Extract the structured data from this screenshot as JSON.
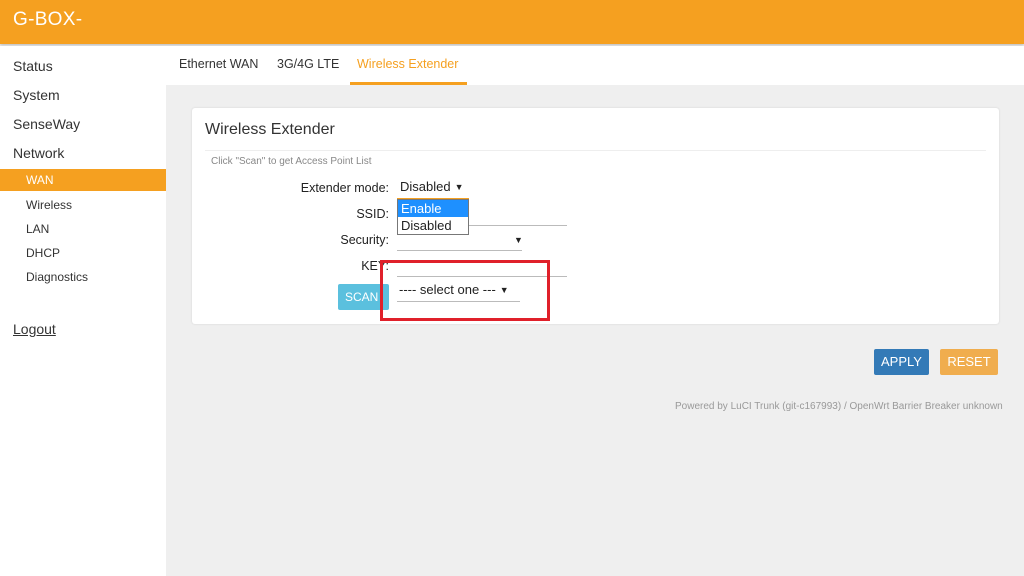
{
  "app": {
    "logo": "G-BOX-"
  },
  "sidebar": {
    "items": [
      "Status",
      "System",
      "SenseWay",
      "Network"
    ],
    "sub_items": [
      "WAN",
      "Wireless",
      "LAN",
      "DHCP",
      "Diagnostics"
    ],
    "active": "WAN",
    "logout": "Logout"
  },
  "tabs": [
    {
      "label": "Ethernet WAN"
    },
    {
      "label": "3G/4G LTE"
    },
    {
      "label": "Wireless Extender",
      "active": true
    }
  ],
  "panel": {
    "title": "Wireless Extender",
    "hint": "Click \"Scan\" to get Access Point List",
    "fields": {
      "extender_mode": {
        "label": "Extender mode:",
        "value": "Disabled"
      },
      "ssid": {
        "label": "SSID:"
      },
      "security": {
        "label": "Security:"
      },
      "key": {
        "label": "KEY:",
        "select_value": "---- select one ---"
      }
    },
    "dropdown_options": [
      "Enable",
      "Disabled"
    ],
    "dropdown_selected": "Enable",
    "scan_label": "SCAN"
  },
  "actions": {
    "apply": "APPLY",
    "reset": "RESET"
  },
  "footer": "Powered by LuCI Trunk (git-c167993) / OpenWrt Barrier Breaker unknown",
  "colors": {
    "accent": "#f5a020",
    "apply": "#337ab7",
    "reset": "#f0ad4e",
    "scan": "#5bc0de",
    "highlight": "#e0202a"
  },
  "icons": {
    "dropdown_caret": "caret-down-icon"
  }
}
